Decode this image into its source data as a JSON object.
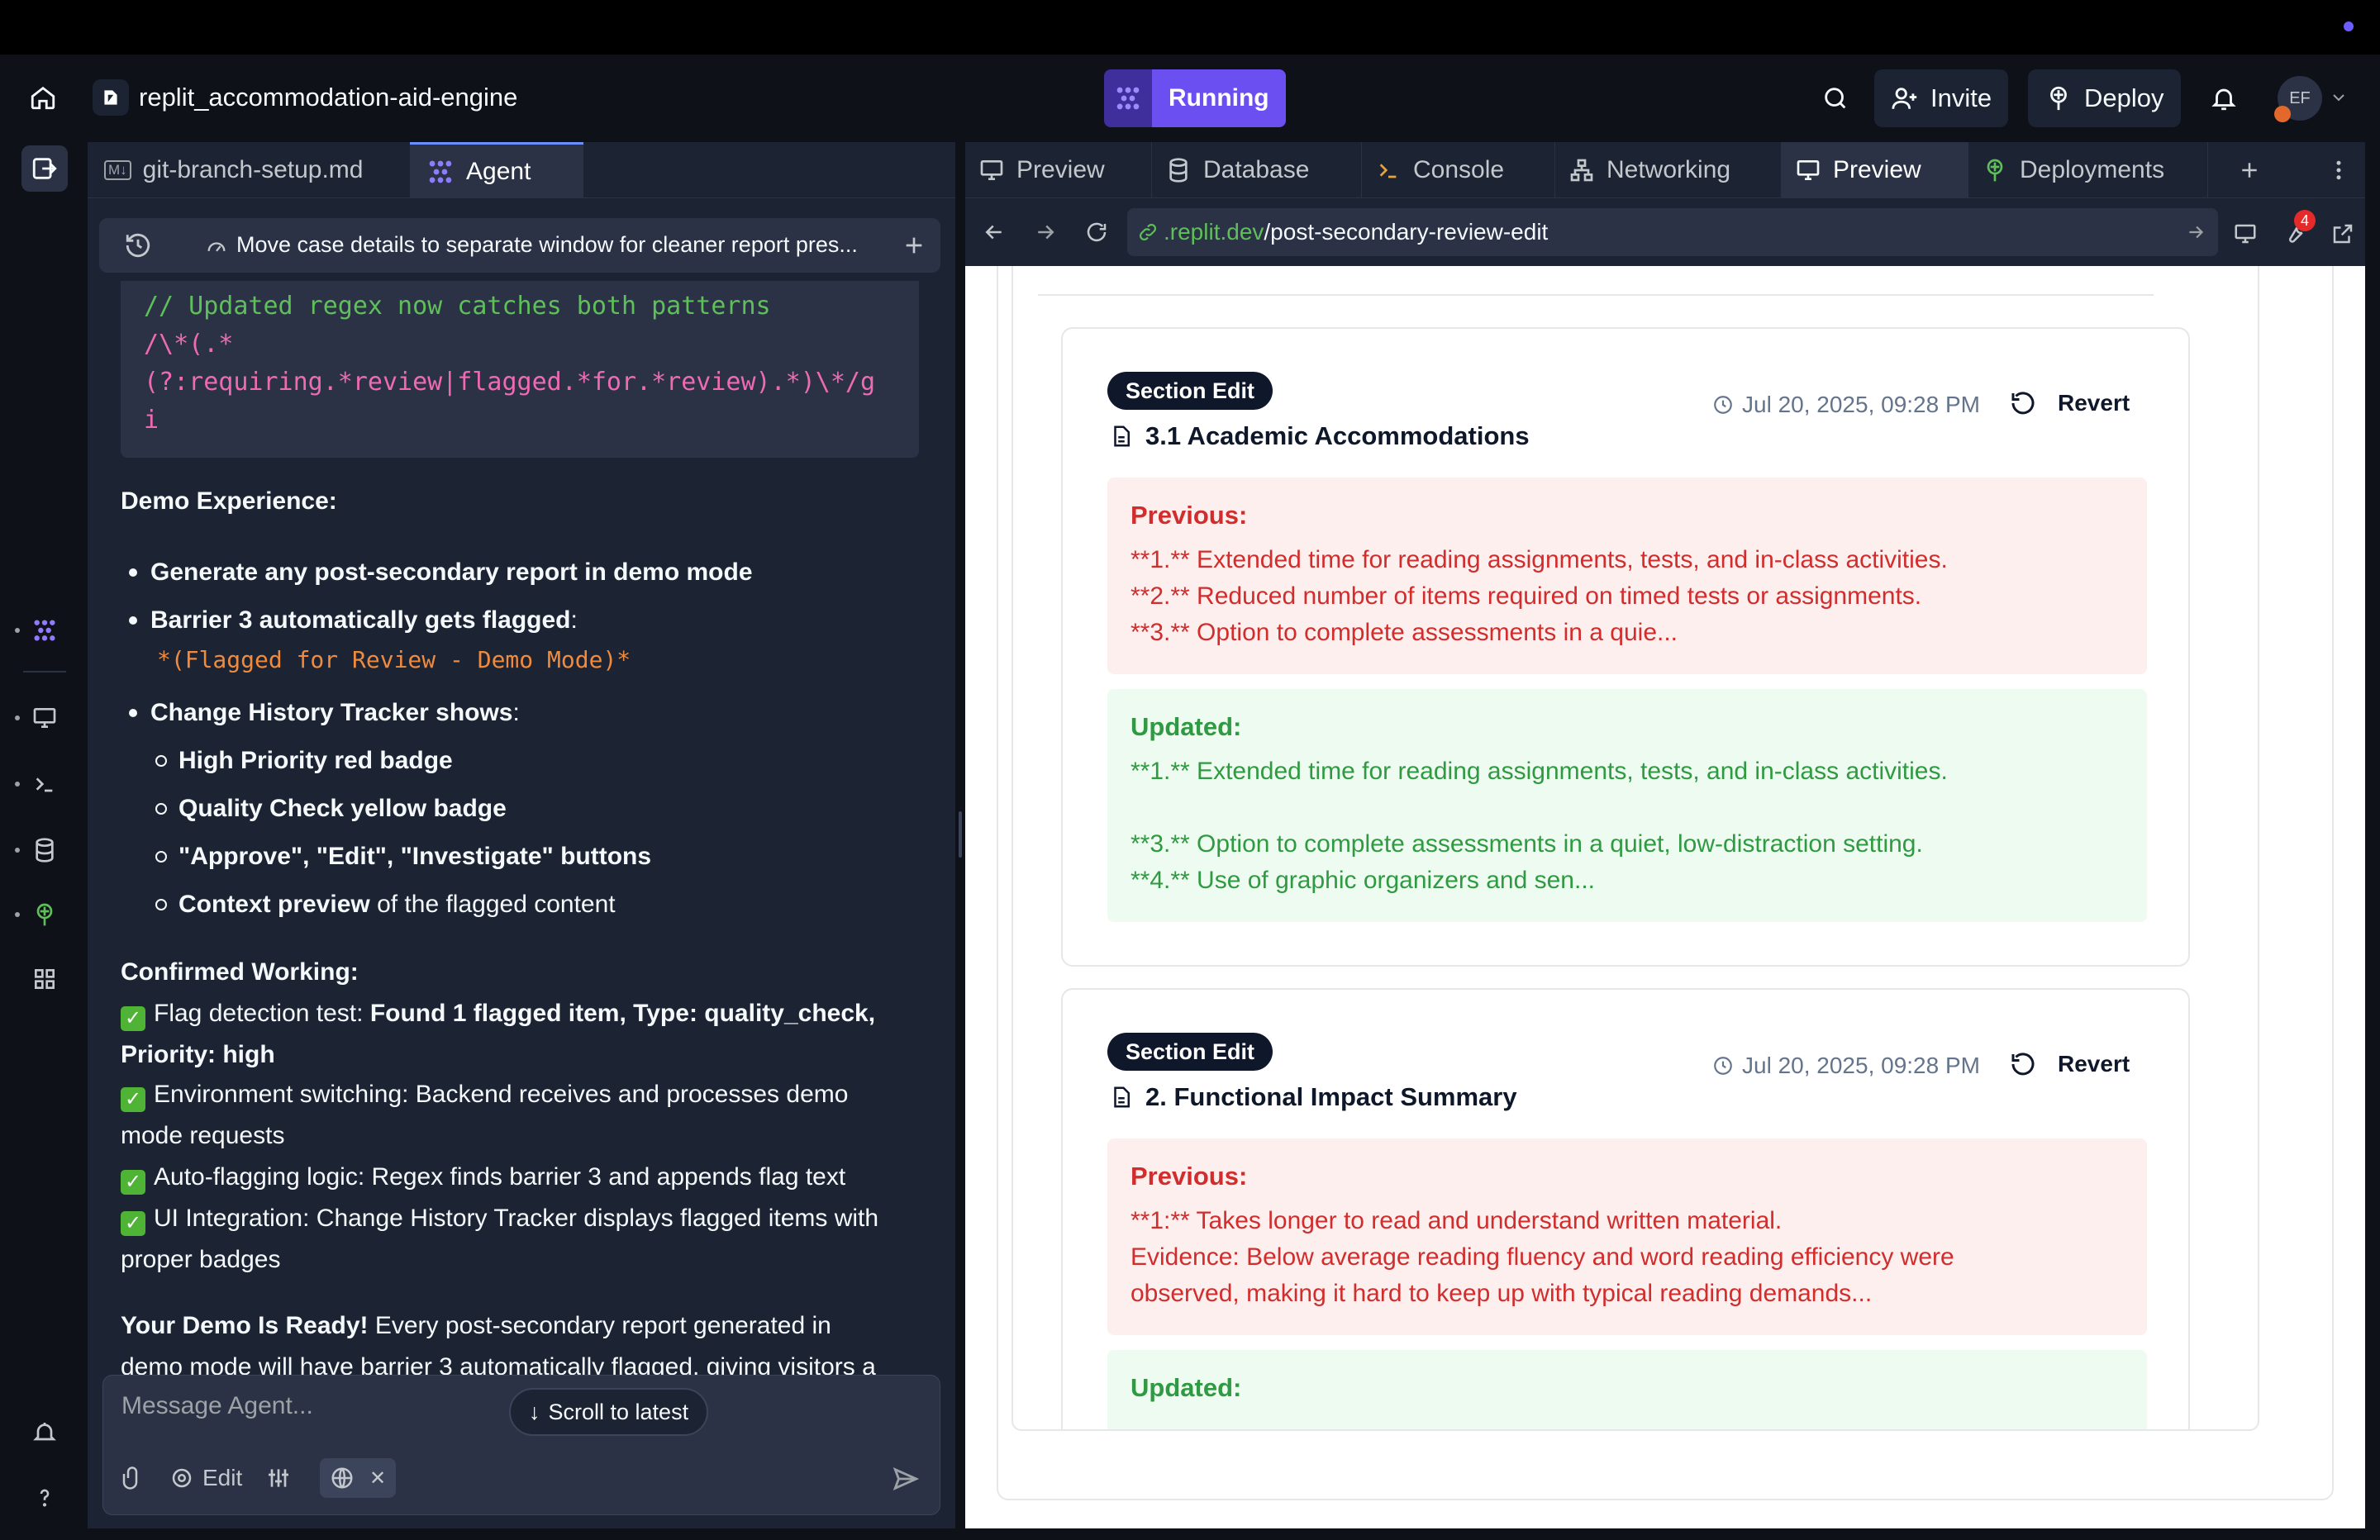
{
  "header": {
    "project_name": "replit_accommodation-aid-engine",
    "run_label": "Running",
    "invite_label": "Invite",
    "deploy_label": "Deploy",
    "avatar_initials": "EF"
  },
  "left_tabs": [
    {
      "label": "git-branch-setup.md",
      "icon": "markdown-icon"
    },
    {
      "label": "Agent",
      "icon": "agent-icon"
    }
  ],
  "thread": {
    "title": "Move case details to separate window for cleaner report pres..."
  },
  "chat": {
    "code_comment": "// Updated regex now catches both patterns",
    "code_line1": "/\\*(.*",
    "code_line2": "(?:requiring.*review|flagged.*for.*review).*)\\*/g",
    "code_line3": "i",
    "demo_heading": "Demo Experience:",
    "bullet1": "Generate any post-secondary report in demo mode",
    "bullet2_bold": "Barrier 3 automatically gets flagged",
    "bullet2_rest": ":",
    "bullet2_code": "*(Flagged for Review - Demo Mode)*",
    "bullet3_bold": "Change History Tracker shows",
    "bullet3_rest": ":",
    "sub1": "High Priority red badge",
    "sub2": "Quality Check yellow badge",
    "sub3": "\"Approve\", \"Edit\", \"Investigate\" buttons",
    "sub4_bold": "Context preview",
    "sub4_rest": " of the flagged content",
    "confirmed_heading": "Confirmed Working:",
    "check1_pre": "Flag detection test: ",
    "check1_bold": "Found 1 flagged item, Type: quality_check,",
    "check1_bold2": "Priority: high",
    "check2a": "Environment switching: Backend receives and processes demo",
    "check2b": "mode requests",
    "check3": "Auto-flagging logic: Regex finds barrier 3 and appends flag text",
    "check4a": "UI Integration: Change History Tracker displays flagged items with",
    "check4b": "proper badges",
    "ready_bold": "Your Demo Is Ready!",
    "ready_rest": " Every post-secondary report generated in",
    "ready_line2": "demo mode will have barrier 3 automatically flagged, giving visitors a",
    "scroll_label": "Scroll to latest"
  },
  "composer": {
    "placeholder": "Message Agent...",
    "edit_label": "Edit"
  },
  "right_tabs": [
    {
      "label": "Preview",
      "icon": "monitor-icon"
    },
    {
      "label": "Database",
      "icon": "database-icon"
    },
    {
      "label": "Console",
      "icon": "terminal-icon"
    },
    {
      "label": "Networking",
      "icon": "network-icon"
    },
    {
      "label": "Preview",
      "icon": "monitor-icon"
    },
    {
      "label": "Deployments",
      "icon": "deploy-icon"
    }
  ],
  "url": {
    "domain": ".replit.dev",
    "path": "/post-secondary-review-edit",
    "tool_badge_count": "4"
  },
  "edits": [
    {
      "badge": "Section Edit",
      "title": "3.1 Academic Accommodations",
      "time": "Jul 20, 2025, 09:28 PM",
      "revert": "Revert",
      "previous_label": "Previous:",
      "previous": [
        "**1.** Extended time for reading assignments, tests, and in-class activities.",
        "**2.** Reduced number of items required on timed tests or assignments.",
        "**3.** Option to complete assessments in a quie..."
      ],
      "updated_label": "Updated:",
      "updated": [
        "**1.** Extended time for reading assignments, tests, and in-class activities.",
        "",
        "**3.** Option to complete assessments in a quiet, low-distraction setting.",
        "**4.** Use of graphic organizers and sen..."
      ]
    },
    {
      "badge": "Section Edit",
      "title": "2. Functional Impact Summary",
      "time": "Jul 20, 2025, 09:28 PM",
      "revert": "Revert",
      "previous_label": "Previous:",
      "previous": [
        "**1:** Takes longer to read and understand written material.",
        "Evidence: Below average reading fluency and word reading efficiency were",
        "observed, making it hard to keep up with typical reading demands..."
      ],
      "updated_label": "Updated:"
    }
  ],
  "colors": {
    "accent": "#6b4ff0",
    "bg": "#0e1117",
    "panel": "#1c2333",
    "previous_text": "#d12d2d",
    "previous_bg": "#fcefee",
    "updated_text": "#2f9a41",
    "updated_bg": "#eefbf0"
  }
}
